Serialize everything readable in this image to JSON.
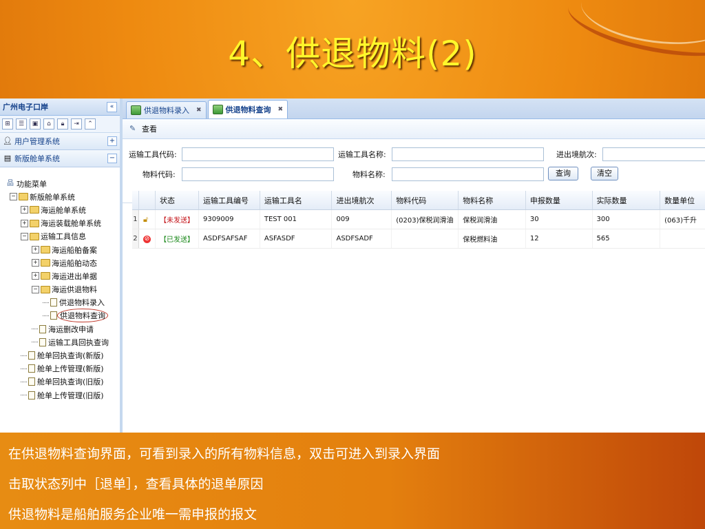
{
  "slide": {
    "title": "4、供退物料(2)",
    "caption": [
      "在供退物料查询界面，可看到录入的所有物料信息，双击可进入到录入界面",
      "击取状态列中［退单］，查看具体的退单原因",
      "供退物料是船舶服务企业唯一需申报的报文"
    ]
  },
  "left_panel": {
    "title": "广州电子口岸",
    "collapse_symbol": "«",
    "accordion": [
      {
        "label": "用户管理系统",
        "toggle": "+"
      },
      {
        "label": "新版舱单系统",
        "toggle": "−"
      }
    ],
    "tree": {
      "root": "功能菜单",
      "items": [
        {
          "label": "新版舱单系统",
          "level": 0,
          "type": "folder",
          "expander": "−"
        },
        {
          "label": "海运舱单系统",
          "level": 1,
          "type": "folder",
          "expander": "+"
        },
        {
          "label": "海运装载舱单系统",
          "level": 1,
          "type": "folder",
          "expander": "+"
        },
        {
          "label": "运输工具信息",
          "level": 1,
          "type": "folder",
          "expander": "−"
        },
        {
          "label": "海运船舶备案",
          "level": 2,
          "type": "folder",
          "expander": "+"
        },
        {
          "label": "海运船舶动态",
          "level": 2,
          "type": "folder",
          "expander": "+"
        },
        {
          "label": "海运进出单据",
          "level": 2,
          "type": "folder",
          "expander": "+"
        },
        {
          "label": "海运供退物料",
          "level": 2,
          "type": "folder",
          "expander": "−"
        },
        {
          "label": "供退物料录入",
          "level": 3,
          "type": "doc"
        },
        {
          "label": "供退物料查询",
          "level": 3,
          "type": "doc",
          "highlighted": true
        },
        {
          "label": "海运删改申请",
          "level": 2,
          "type": "doc"
        },
        {
          "label": "运输工具回执查询",
          "level": 2,
          "type": "doc"
        },
        {
          "label": "舱单回执查询(新版)",
          "level": 1,
          "type": "doc"
        },
        {
          "label": "舱单上传管理(新版)",
          "level": 1,
          "type": "doc"
        },
        {
          "label": "舱单回执查询(旧版)",
          "level": 1,
          "type": "doc"
        },
        {
          "label": "舱单上传管理(旧版)",
          "level": 1,
          "type": "doc"
        }
      ]
    }
  },
  "tabs": [
    {
      "label": "供退物料录入",
      "active": false
    },
    {
      "label": "供退物料查询",
      "active": true
    }
  ],
  "toolbar": {
    "view_label": "查看"
  },
  "form": {
    "vessel_code_label": "运输工具代码:",
    "vessel_name_label": "运输工具名称:",
    "voyage_label": "进出境航次:",
    "material_code_label": "物料代码:",
    "material_name_label": "物料名称:",
    "query_button": "查询",
    "clear_button": "清空"
  },
  "grid": {
    "columns": [
      "状态",
      "运输工具编号",
      "运输工具名",
      "进出境航次",
      "物料代码",
      "物料名称",
      "申报数量",
      "实际数量",
      "数量单位"
    ],
    "rows": [
      {
        "n": "1",
        "icon": "unlock-icon",
        "status": "【未发送】",
        "status_color": "#c4141a",
        "vessel_no": "9309009",
        "vessel_name": "TEST 001",
        "voyage": "009",
        "mat_code": "(0203)保税润滑油",
        "mat_name": "保税润滑油",
        "declared": "30",
        "actual": "300",
        "unit": "(063)千升"
      },
      {
        "n": "2",
        "icon": "no-entry-icon",
        "status": "【已发送】",
        "status_color": "#1d8a1d",
        "vessel_no": "ASDFSAFSAF",
        "vessel_name": "ASFASDF",
        "voyage": "ASDFSADF",
        "mat_code": "",
        "mat_name": "保税燃料油",
        "declared": "12",
        "actual": "565",
        "unit": ""
      }
    ]
  },
  "colors": {
    "title": "#fff72b",
    "status_unsent": "#c4141a",
    "status_sent": "#1d8a1d"
  }
}
